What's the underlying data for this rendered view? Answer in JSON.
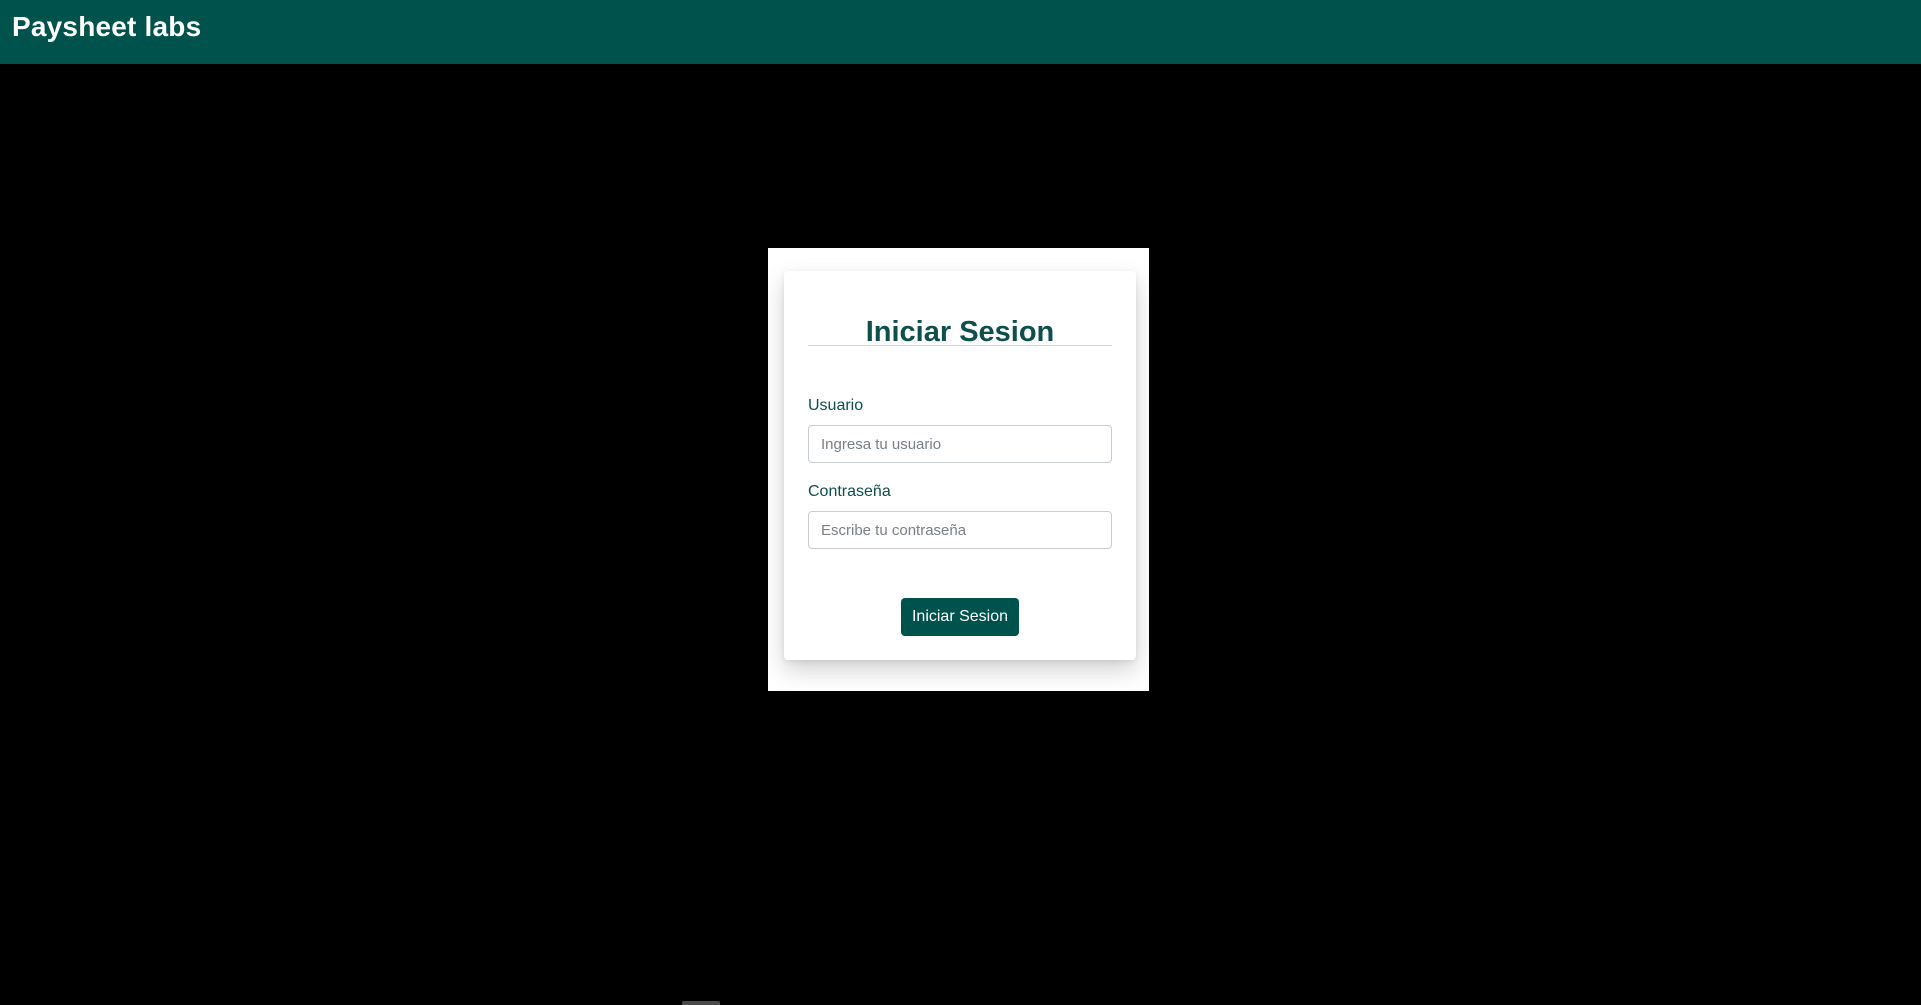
{
  "app": {
    "brand": "Paysheet labs"
  },
  "colors": {
    "primary": "#00524d",
    "title": "#0d4f4c",
    "background": "#000000",
    "card": "#ffffff"
  },
  "login_card": {
    "title": "Iniciar Sesion",
    "username": {
      "label": "Usuario",
      "value": "",
      "placeholder": "Ingresa tu usuario"
    },
    "password": {
      "label": "Contraseña",
      "value": "",
      "placeholder": "Escribe tu contraseña"
    },
    "submit_label": "Iniciar Sesion"
  }
}
